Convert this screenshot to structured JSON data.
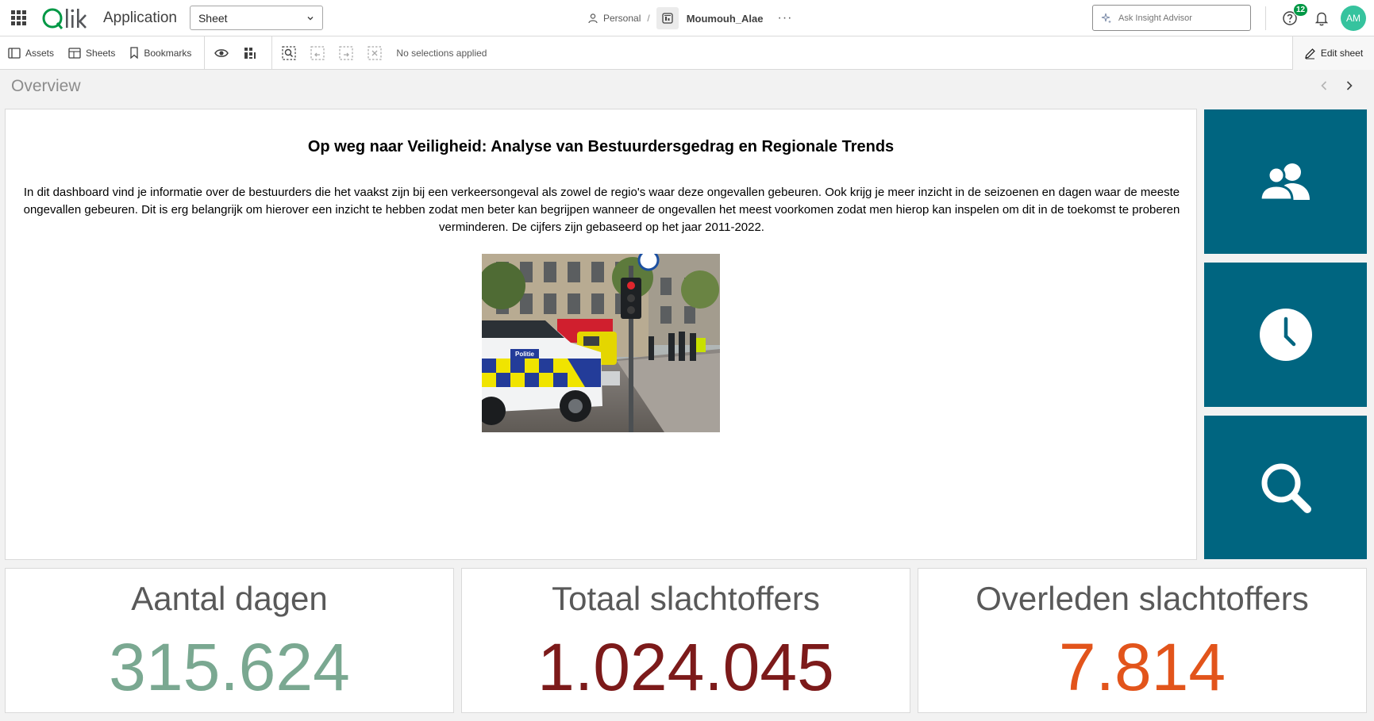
{
  "header": {
    "app_name": "Application",
    "sheet_select": "Sheet",
    "space": "Personal",
    "separator": "/",
    "app_owner": "Moumouh_Alae",
    "more": "···",
    "insight_placeholder": "Ask Insight Advisor",
    "help_badge": "12",
    "avatar_initials": "AM"
  },
  "toolbar": {
    "assets": "Assets",
    "sheets": "Sheets",
    "bookmarks": "Bookmarks",
    "no_selections": "No selections applied",
    "edit_sheet": "Edit sheet"
  },
  "sheet": {
    "title": "Overview"
  },
  "panel": {
    "title": "Op weg naar Veiligheid: Analyse van Bestuurdersgedrag en Regionale Trends",
    "body": "In dit dashboard vind je informatie over de bestuurders die het vaakst zijn bij een verkeersongeval als zowel de regio's waar deze ongevallen gebeuren. Ook krijg je meer inzicht in de seizoenen en dagen waar de meeste ongevallen gebeuren. Dit is erg belangrijk om hierover een inzicht te hebben zodat men beter kan begrijpen wanneer de ongevallen het meest voorkomen zodat men hierop kan inspelen om dit in de toekomst te proberen verminderen. De cijfers zijn gebaseerd op het jaar 2011-2022.",
    "photo_text": "Politie"
  },
  "tiles": [
    {
      "icon": "users-icon"
    },
    {
      "icon": "clock-icon"
    },
    {
      "icon": "search-icon"
    }
  ],
  "kpis": [
    {
      "title": "Aantal dagen",
      "value": "315.624",
      "color": "#7aa891"
    },
    {
      "title": "Totaal slachtoffers",
      "value": "1.024.045",
      "color": "#7c1a1a"
    },
    {
      "title": "Overleden slachtoffers",
      "value": "7.814",
      "color": "#e2541b"
    }
  ],
  "colors": {
    "tile": "#006580",
    "brand_green": "#009845",
    "avatar": "#36c39e"
  }
}
